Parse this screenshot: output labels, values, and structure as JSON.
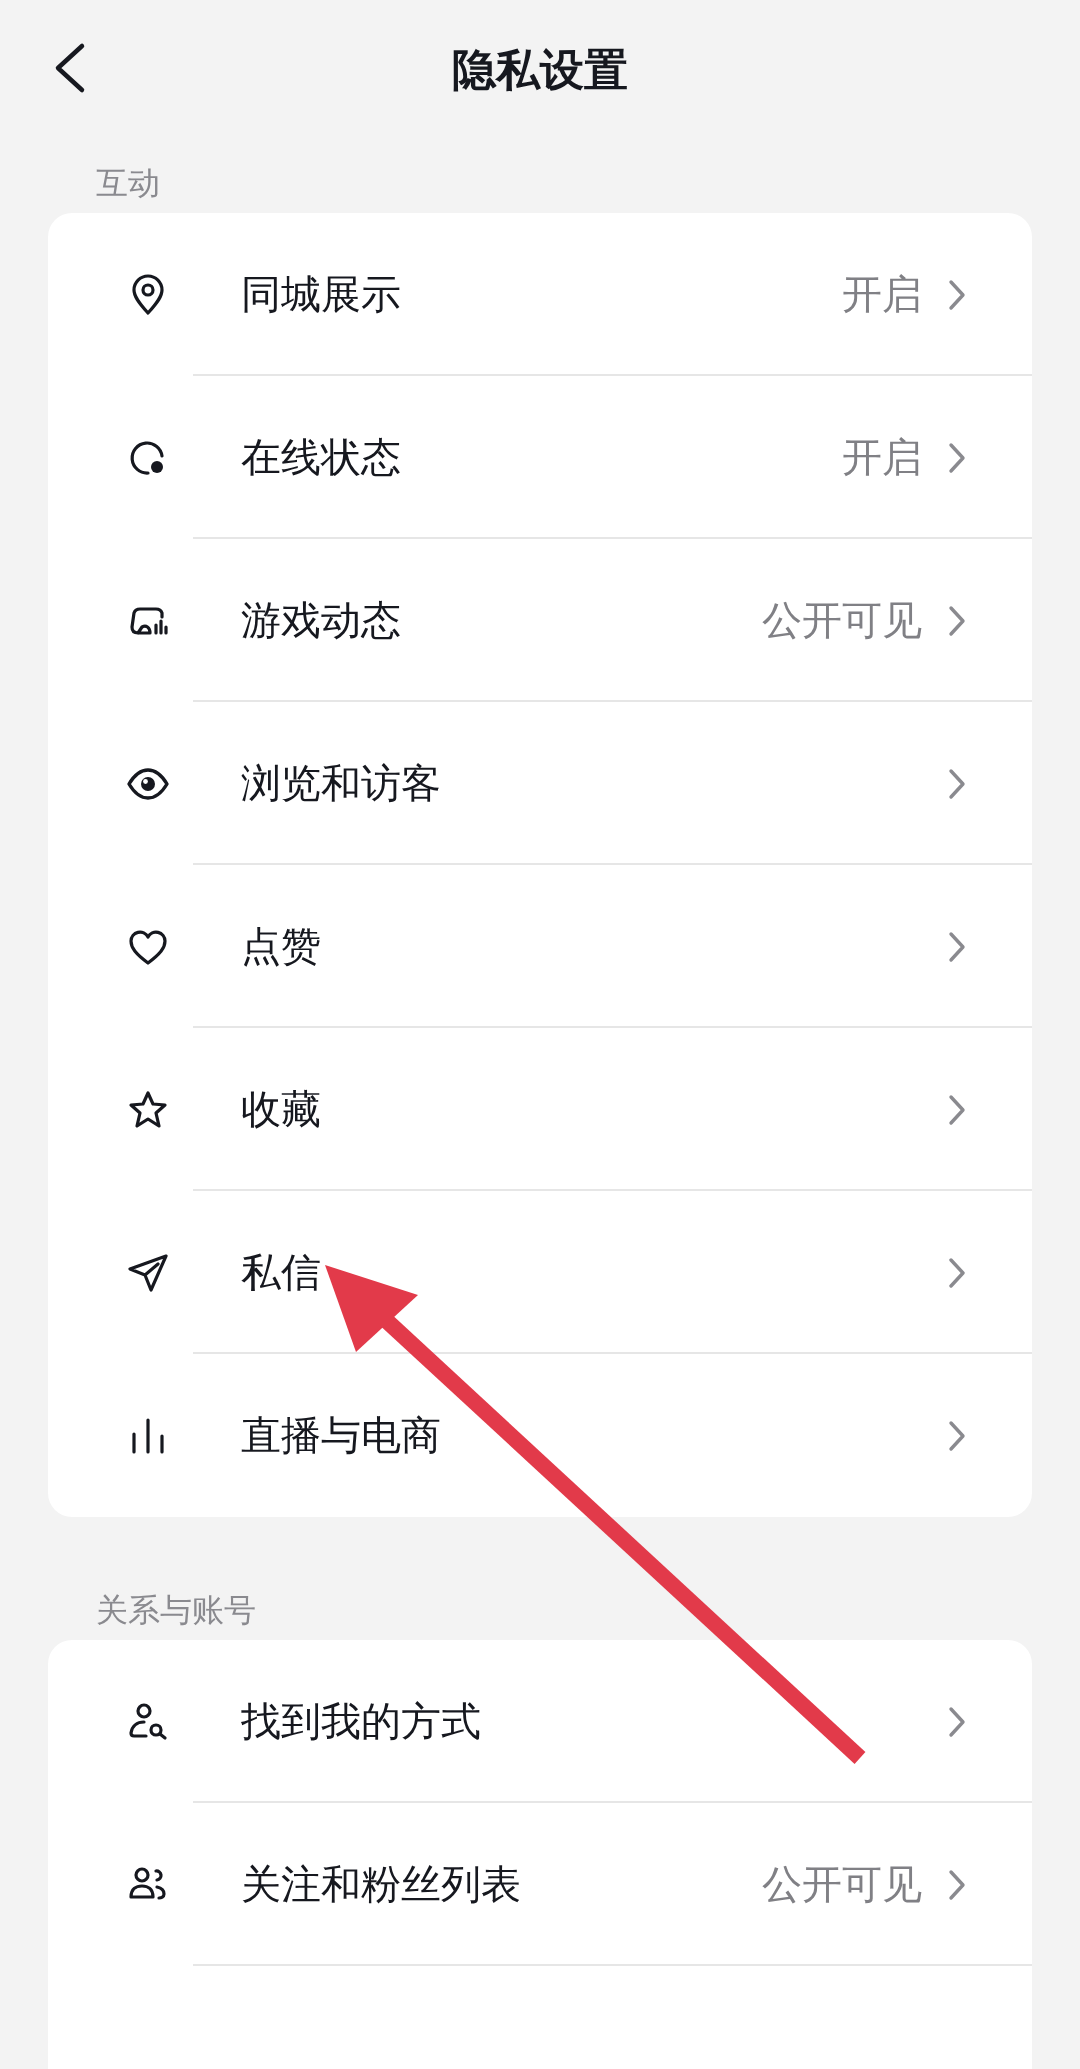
{
  "header": {
    "title": "隐私设置"
  },
  "sections": [
    {
      "title": "互动",
      "rows": [
        {
          "label": "同城展示",
          "value": "开启"
        },
        {
          "label": "在线状态",
          "value": "开启"
        },
        {
          "label": "游戏动态",
          "value": "公开可见"
        },
        {
          "label": "浏览和访客"
        },
        {
          "label": "点赞"
        },
        {
          "label": "收藏"
        },
        {
          "label": "私信"
        },
        {
          "label": "直播与电商"
        }
      ]
    },
    {
      "title": "关系与账号",
      "rows": [
        {
          "label": "找到我的方式"
        },
        {
          "label": "关注和粉丝列表",
          "value": "公开可见"
        }
      ]
    }
  ],
  "annotation": {
    "kind": "arrow"
  }
}
